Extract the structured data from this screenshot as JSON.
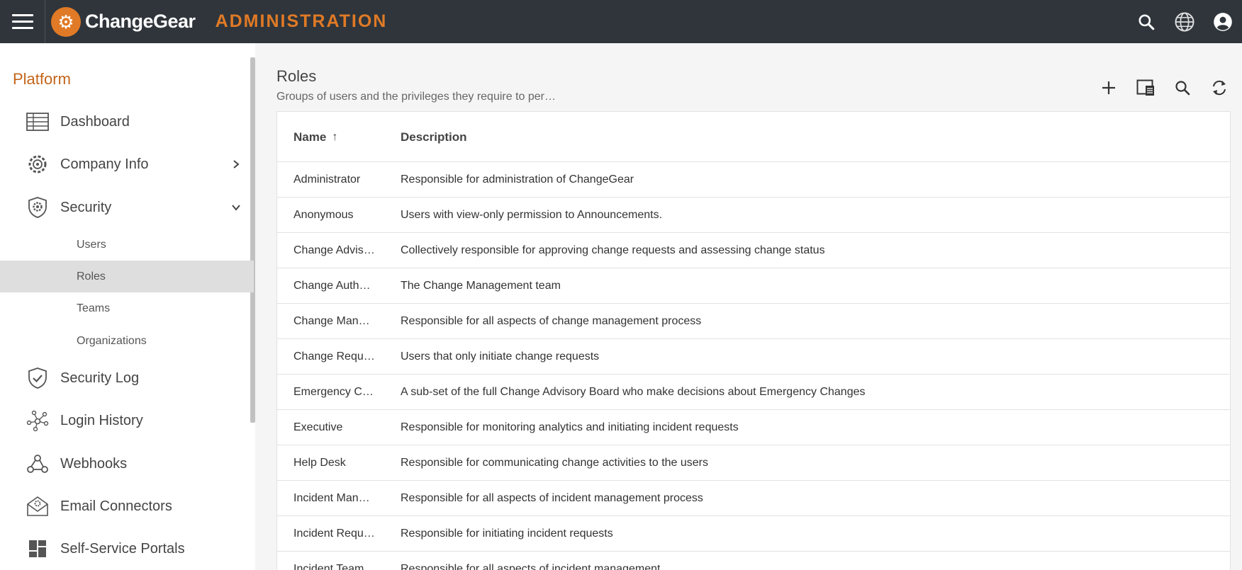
{
  "header": {
    "app_name": "ChangeGear",
    "section_title": "ADMINISTRATION",
    "accent_color": "#e07a26",
    "icons": [
      "menu-icon",
      "search-icon",
      "globe-icon",
      "account-icon"
    ]
  },
  "sidebar": {
    "heading": "Platform",
    "items": [
      {
        "label": "Dashboard",
        "icon": "table-icon"
      },
      {
        "label": "Company Info",
        "icon": "gear-cog-icon",
        "chevron": "right"
      },
      {
        "label": "Security",
        "icon": "shield-gear-icon",
        "chevron": "down"
      },
      {
        "label": "Security Log",
        "icon": "shield-check-icon"
      },
      {
        "label": "Login History",
        "icon": "network-icon"
      },
      {
        "label": "Webhooks",
        "icon": "webhook-icon"
      },
      {
        "label": "Email Connectors",
        "icon": "email-gear-icon"
      },
      {
        "label": "Self-Service Portals",
        "icon": "dashboard-tiles-icon"
      }
    ],
    "sub_items": [
      {
        "label": "Users"
      },
      {
        "label": "Roles",
        "active": true
      },
      {
        "label": "Teams"
      },
      {
        "label": "Organizations"
      }
    ]
  },
  "main": {
    "title": "Roles",
    "subtitle": "Groups of users and the privileges they require to per…",
    "toolbar": [
      "add-icon",
      "column-chooser-icon",
      "search-icon",
      "refresh-icon"
    ]
  },
  "table": {
    "columns": {
      "name": "Name",
      "description": "Description",
      "sort_indicator": "↑"
    },
    "rows": [
      {
        "name": "Administrator",
        "description": "Responsible for administration of ChangeGear"
      },
      {
        "name": "Anonymous",
        "description": "Users with view-only permission to Announcements."
      },
      {
        "name": "Change Advis…",
        "description": "Collectively responsible for approving change requests and assessing change status"
      },
      {
        "name": "Change Autho…",
        "description": "The Change Management team"
      },
      {
        "name": "Change Mana…",
        "description": "Responsible for all aspects of change management process"
      },
      {
        "name": "Change Requ…",
        "description": "Users that only initiate change requests"
      },
      {
        "name": "Emergency C…",
        "description": "A sub-set of the full Change Advisory Board who make decisions about Emergency Changes"
      },
      {
        "name": "Executive",
        "description": "Responsible for monitoring analytics and initiating incident requests"
      },
      {
        "name": "Help Desk",
        "description": "Responsible for communicating change activities to the users"
      },
      {
        "name": "Incident Mana…",
        "description": "Responsible for all aspects of incident management process"
      },
      {
        "name": "Incident Requ…",
        "description": "Responsible for initiating incident requests"
      },
      {
        "name": "Incident Team",
        "description": "Responsible for all aspects of incident management"
      }
    ]
  }
}
